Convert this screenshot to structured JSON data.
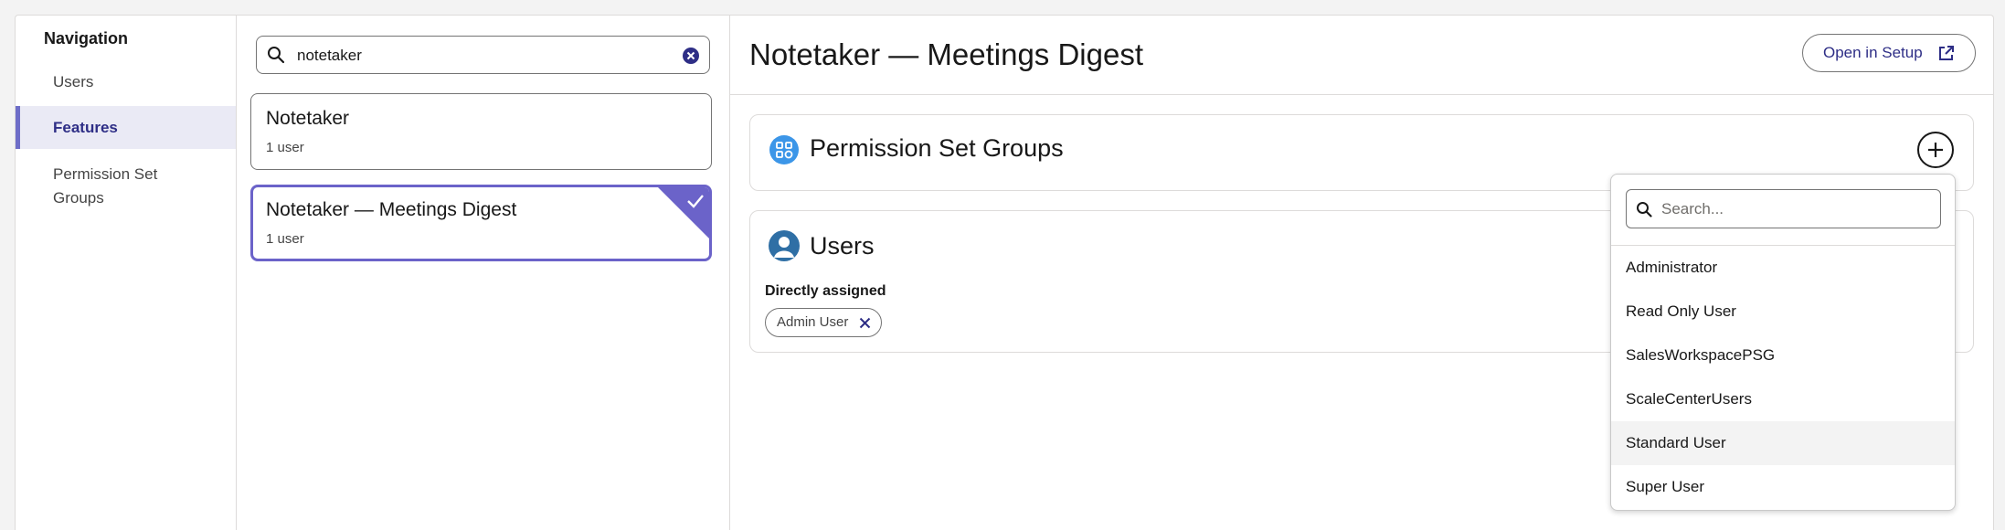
{
  "nav": {
    "title": "Navigation",
    "items": [
      {
        "label": "Users",
        "active": false
      },
      {
        "label": "Features",
        "active": true
      },
      {
        "label": "Permission Set",
        "label2": "Groups",
        "active": false
      }
    ]
  },
  "list": {
    "search_value": "notetaker",
    "cards": [
      {
        "title": "Notetaker",
        "subtitle": "1 user",
        "selected": false
      },
      {
        "title": "Notetaker — Meetings Digest",
        "subtitle": "1 user",
        "selected": true
      }
    ]
  },
  "detail": {
    "title": "Notetaker — Meetings Digest",
    "open_button": "Open in Setup",
    "psg_panel": {
      "title": "Permission Set Groups"
    },
    "users_panel": {
      "title": "Users",
      "subheading": "Directly assigned",
      "pills": [
        "Admin User"
      ]
    }
  },
  "dropdown": {
    "placeholder": "Search...",
    "items": [
      "Administrator",
      "Read Only User",
      "SalesWorkspacePSG",
      "ScaleCenterUsers",
      "Standard User",
      "Super User"
    ],
    "hover_item": "Standard User"
  },
  "colors": {
    "accent": "#6b63c9",
    "brand_text": "#2e2e86",
    "psg_icon": "#3c96e8",
    "user_icon": "#2f6fa5"
  }
}
